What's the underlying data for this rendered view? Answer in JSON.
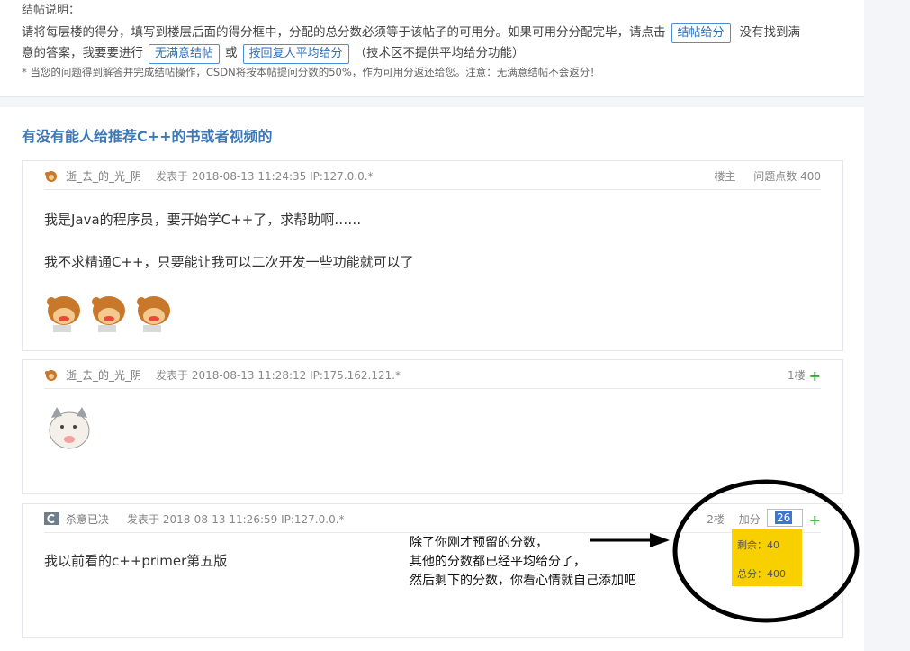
{
  "notice": {
    "title": "结帖说明：",
    "line1_text": "请将每层楼的得分，填写到楼层后面的得分框中，分配的总分数必须等于该帖子的可用分。如果可用分分配完毕，请点击",
    "btn_close": "结帖给分",
    "line1_tail": "没有找到满",
    "line2_text": "意的答案，我要要进行",
    "btn_unsatisfied": "无满意结帖",
    "or_text": "或",
    "btn_average": "按回复人平均给分",
    "line2_tail": "（技术区不提供平均给分功能）",
    "small_note": "* 当您的问题得到解答并完成结帖操作，CSDN将按本帖提问分数的50%，作为可用分返还给您。注意：无满意结帖不会返分！"
  },
  "topic": {
    "title": "有没有能人给推荐C++的书或者视频的"
  },
  "posts": [
    {
      "author": "逝_去_的_光_阴",
      "time": "发表于 2018-08-13 11:24:35 IP:127.0.0.*",
      "floor": "楼主",
      "points": "问题点数 400",
      "lines": [
        "我是Java的程序员，要开始学C++了，求帮助啊……",
        "我不求精通C++，只要能让我可以二次开发一些功能就可以了"
      ]
    },
    {
      "author": "逝_去_的_光_阴",
      "time": "发表于 2018-08-13 11:28:12 IP:175.162.121.*",
      "floor": "1楼"
    },
    {
      "author": "杀意已决",
      "time": "发表于 2018-08-13 11:26:59 IP:127.0.0.*",
      "floor": "2楼",
      "add_label": "加分",
      "score_value": "26",
      "lines": [
        "我以前看的c++primer第五版"
      ]
    }
  ],
  "popup": {
    "remaining": "剩余：40",
    "total": "总分：400"
  },
  "annotation": {
    "line1": "除了你刚才预留的分数，",
    "line2": "其他的分数都已经平均给分了，",
    "line3": "然后剩下的分数，你看心情就自己添加吧"
  },
  "colors": {
    "accent": "#3d78b5",
    "popup": "#f8d000",
    "plus": "#3aa83a"
  }
}
